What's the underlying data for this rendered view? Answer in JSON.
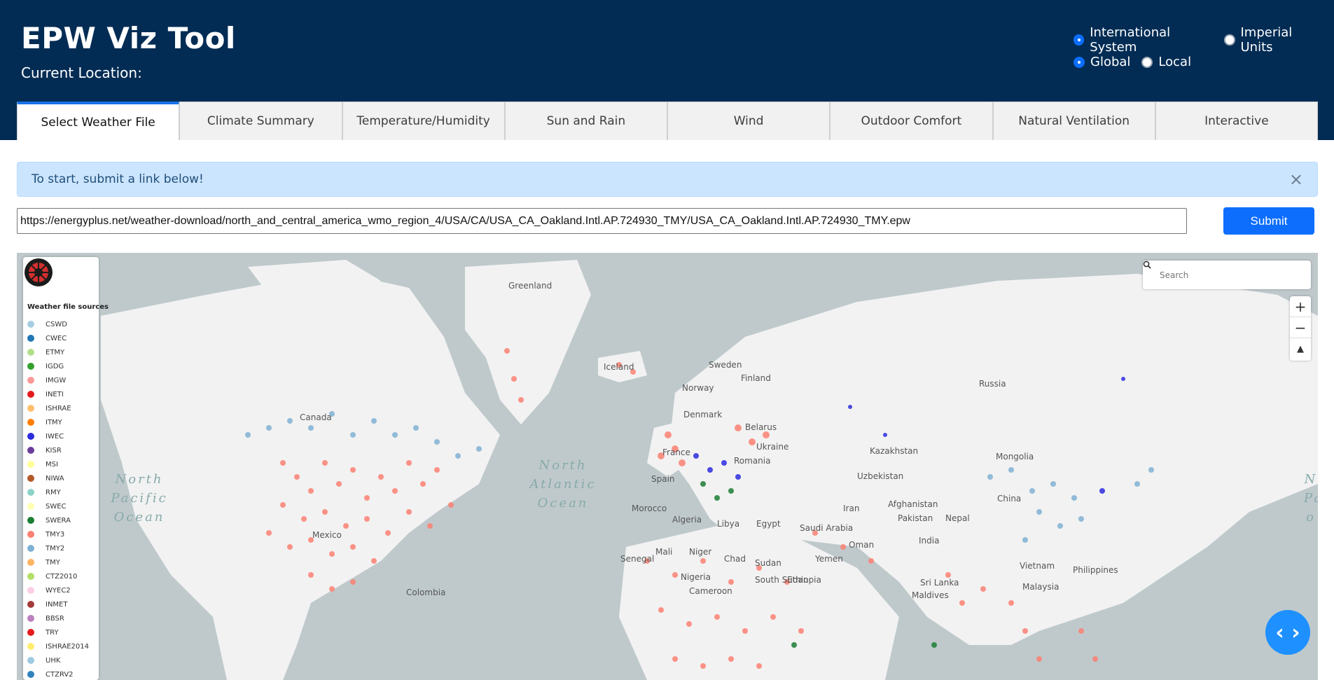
{
  "app": {
    "title": "EPW Viz Tool",
    "location_label": "Current Location:"
  },
  "units": {
    "options": [
      "International System",
      "Imperial Units"
    ],
    "selected": "International System"
  },
  "scope": {
    "options": [
      "Global",
      "Local"
    ],
    "selected": "Global"
  },
  "tabs": [
    {
      "label": "Select Weather File",
      "active": true
    },
    {
      "label": "Climate Summary"
    },
    {
      "label": "Temperature/Humidity"
    },
    {
      "label": "Sun and Rain"
    },
    {
      "label": "Wind"
    },
    {
      "label": "Outdoor Comfort"
    },
    {
      "label": "Natural Ventilation"
    },
    {
      "label": "Interactive"
    }
  ],
  "alert": {
    "text": "To start, submit a link below!",
    "close": "×"
  },
  "url_form": {
    "value": "https://energyplus.net/weather-download/north_and_central_america_wmo_region_4/USA/CA/USA_CA_Oakland.Intl.AP.724930_TMY/USA_CA_Oakland.Intl.AP.724930_TMY.epw",
    "submit_label": "Submit"
  },
  "map": {
    "search_placeholder": "Search",
    "legend_title": "Weather file sources",
    "legend": [
      {
        "name": "CSWD",
        "color": "#a6cee3"
      },
      {
        "name": "CWEC",
        "color": "#1f78b4"
      },
      {
        "name": "ETMY",
        "color": "#b2df8a"
      },
      {
        "name": "IGDG",
        "color": "#33a02c"
      },
      {
        "name": "IMGW",
        "color": "#fb9a99"
      },
      {
        "name": "INETI",
        "color": "#e31a1c"
      },
      {
        "name": "ISHRAE",
        "color": "#fdbf6f"
      },
      {
        "name": "ITMY",
        "color": "#ff7f00"
      },
      {
        "name": "IWEC",
        "color": "#2b2be0"
      },
      {
        "name": "KISR",
        "color": "#6a3d9a"
      },
      {
        "name": "MSI",
        "color": "#ffff99"
      },
      {
        "name": "NIWA",
        "color": "#b15928"
      },
      {
        "name": "RMY",
        "color": "#8dd3c7"
      },
      {
        "name": "SWEC",
        "color": "#ffffb3"
      },
      {
        "name": "SWERA",
        "color": "#1b7e35"
      },
      {
        "name": "TMY3",
        "color": "#fb8072"
      },
      {
        "name": "TMY2",
        "color": "#80b1d3"
      },
      {
        "name": "TMY",
        "color": "#fdb462"
      },
      {
        "name": "CTZ2010",
        "color": "#b3de69"
      },
      {
        "name": "WYEC2",
        "color": "#fccde5"
      },
      {
        "name": "INMET",
        "color": "#a33a3a"
      },
      {
        "name": "BBSR",
        "color": "#bc80bd"
      },
      {
        "name": "TRY",
        "color": "#e41a1c"
      },
      {
        "name": "ISHRAE2014",
        "color": "#ffed6f"
      },
      {
        "name": "UHK",
        "color": "#9ecae1"
      },
      {
        "name": "CTZRV2",
        "color": "#3182bd"
      }
    ],
    "labels": {
      "greenland": "Greenland",
      "canada": "Canada",
      "iceland": "Iceland",
      "sweden": "Sweden",
      "norway": "Norway",
      "finland": "Finland",
      "denmark": "Denmark",
      "belarus": "Belarus",
      "ukraine": "Ukraine",
      "france": "France",
      "romania": "Romania",
      "russia": "Russia",
      "kazakhstan": "Kazakhstan",
      "mongolia": "Mongolia",
      "uzbekistan": "Uzbekistan",
      "china": "China",
      "afghanistan": "Afghanistan",
      "iran": "Iran",
      "pakistan": "Pakistan",
      "nepal": "Nepal",
      "india": "India",
      "algeria": "Algeria",
      "libya": "Libya",
      "egypt": "Egypt",
      "saudi_arabia": "Saudi Arabia",
      "oman": "Oman",
      "yemen": "Yemen",
      "mali": "Mali",
      "niger": "Niger",
      "chad": "Chad",
      "sudan": "Sudan",
      "south_sudan": "South Sudan",
      "ethiopia": "Ethiopia",
      "nigeria": "Nigeria",
      "cameroon": "Cameroon",
      "mexico": "Mexico",
      "colombia": "Colombia",
      "morocco": "Morocco",
      "spain": "Spain",
      "sri_lanka": "Sri Lanka",
      "maldives": "Maldives",
      "vietnam": "Vietnam",
      "philippines": "Philippines",
      "malaysia": "Malaysia",
      "senegal": "Senegal",
      "ocean_np": "North Pacific Ocean",
      "ocean_na": "North Atlantic Ocean",
      "ocean_np_right": "N Pa o"
    }
  }
}
